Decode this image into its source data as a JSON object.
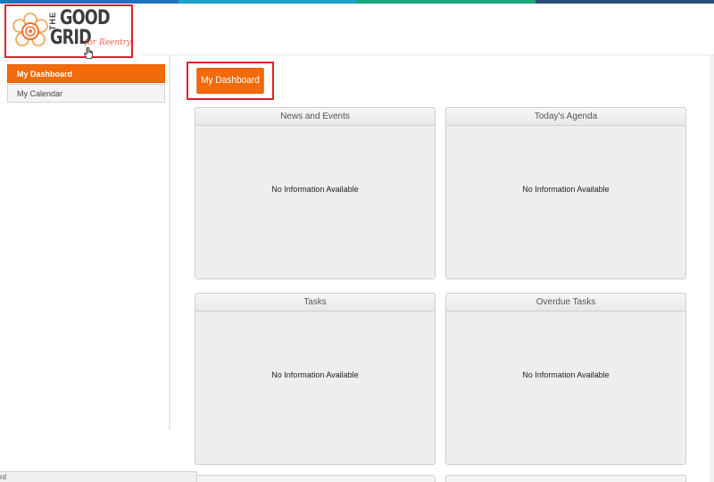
{
  "top_bar_colors": [
    "#1e73be",
    "#19a3c9",
    "#1aa87a",
    "#2a4f7a"
  ],
  "logo": {
    "the": "THE",
    "good": "GOOD",
    "grid": "GRID",
    "tagline": "for Reentry",
    "accent_color": "#f0a050",
    "cursor_icon": "hand-pointer-icon"
  },
  "sidebar": {
    "items": [
      {
        "label": "My Dashboard",
        "active": true
      },
      {
        "label": "My Calendar",
        "active": false
      }
    ]
  },
  "main": {
    "dashboard_button": "My Dashboard",
    "panels": [
      {
        "title": "News and Events",
        "body": "No Information Available"
      },
      {
        "title": "Today's Agenda",
        "body": "No Information Available"
      },
      {
        "title": "Tasks",
        "body": "No Information Available"
      },
      {
        "title": "Overdue Tasks",
        "body": "No Information Available"
      }
    ]
  },
  "status_bar": {
    "text": "rd"
  },
  "colors": {
    "accent": "#f26a0a",
    "highlight": "#e0202c",
    "panel_bg": "#eeeeee"
  }
}
